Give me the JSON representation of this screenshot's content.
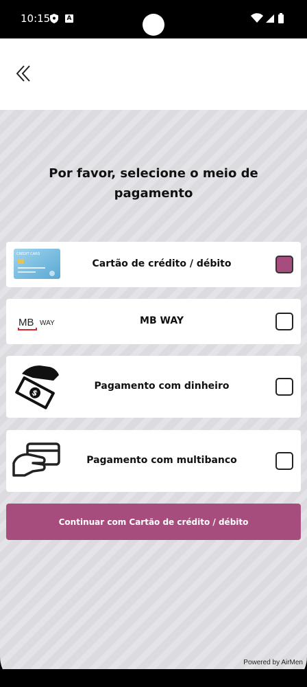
{
  "status_bar": {
    "time": "10:15",
    "a_badge": "A",
    "icons": [
      "shield-icon",
      "a-badge-icon",
      "wifi-icon",
      "signal-icon",
      "battery-icon"
    ]
  },
  "header": {
    "back_icon": "double-chevron-left-icon"
  },
  "title": "Por favor, selecione o meio de pagamento",
  "options": [
    {
      "label": "Cartão de crédito / débito",
      "checked": true,
      "logo_text": "CREDIT CARD",
      "icon": "credit-card-icon"
    },
    {
      "label": "MB WAY",
      "checked": false,
      "logo_mb": "MB",
      "logo_way": "WAY",
      "icon": "mbway-logo"
    },
    {
      "label": "Pagamento com dinheiro",
      "checked": false,
      "icon": "cash-hand-icon"
    },
    {
      "label": "Pagamento com multibanco",
      "checked": false,
      "icon": "card-hand-icon"
    }
  ],
  "continue_label": "Continuar com Cartão de crédito / débito",
  "powered_by": "Powered by AirMen",
  "colors": {
    "accent": "#a64d7e",
    "background": "#dcdbe0",
    "card": "#ffffff"
  }
}
